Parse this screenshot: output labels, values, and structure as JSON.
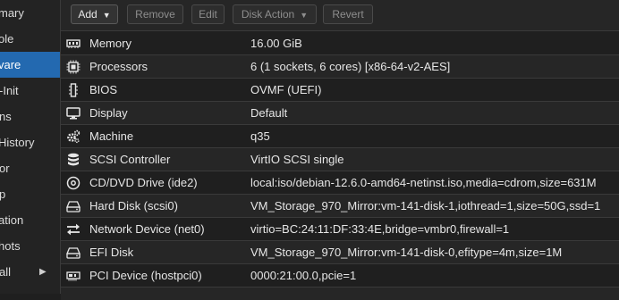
{
  "sidebar": {
    "items": [
      {
        "label": "mary"
      },
      {
        "label": "ole"
      },
      {
        "label": "vare",
        "active": true
      },
      {
        "label": "-Init"
      },
      {
        "label": "ns"
      },
      {
        "label": "History"
      },
      {
        "label": "or"
      },
      {
        "label": "p"
      },
      {
        "label": "ation"
      },
      {
        "label": "hots"
      },
      {
        "label": "all"
      }
    ]
  },
  "toolbar": {
    "add_label": "Add",
    "remove_label": "Remove",
    "edit_label": "Edit",
    "disk_action_label": "Disk Action",
    "revert_label": "Revert"
  },
  "hardware": [
    {
      "name": "Memory",
      "value": "16.00 GiB",
      "icon": "memory-icon"
    },
    {
      "name": "Processors",
      "value": "6 (1 sockets, 6 cores) [x86-64-v2-AES]",
      "icon": "cpu-icon"
    },
    {
      "name": "BIOS",
      "value": "OVMF (UEFI)",
      "icon": "bios-chip-icon"
    },
    {
      "name": "Display",
      "value": "Default",
      "icon": "monitor-icon"
    },
    {
      "name": "Machine",
      "value": "q35",
      "icon": "cogs-icon"
    },
    {
      "name": "SCSI Controller",
      "value": "VirtIO SCSI single",
      "icon": "database-icon"
    },
    {
      "name": "CD/DVD Drive (ide2)",
      "value": "local:iso/debian-12.6.0-amd64-netinst.iso,media=cdrom,size=631M",
      "icon": "cdrom-icon"
    },
    {
      "name": "Hard Disk (scsi0)",
      "value": "VM_Storage_970_Mirror:vm-141-disk-1,iothread=1,size=50G,ssd=1",
      "icon": "hdd-icon"
    },
    {
      "name": "Network Device (net0)",
      "value": "virtio=BC:24:11:DF:33:4E,bridge=vmbr0,firewall=1",
      "icon": "exchange-icon"
    },
    {
      "name": "EFI Disk",
      "value": "VM_Storage_970_Mirror:vm-141-disk-0,efitype=4m,size=1M",
      "icon": "hdd-icon"
    },
    {
      "name": "PCI Device (hostpci0)",
      "value": "0000:21:00.0,pcie=1",
      "icon": "pci-card-icon"
    }
  ],
  "colors": {
    "accent": "#2369b0",
    "background": "#1f1f1f",
    "row_alt": "#262626",
    "text": "#e6e6e6",
    "disabled_text": "#8e8e8e"
  }
}
